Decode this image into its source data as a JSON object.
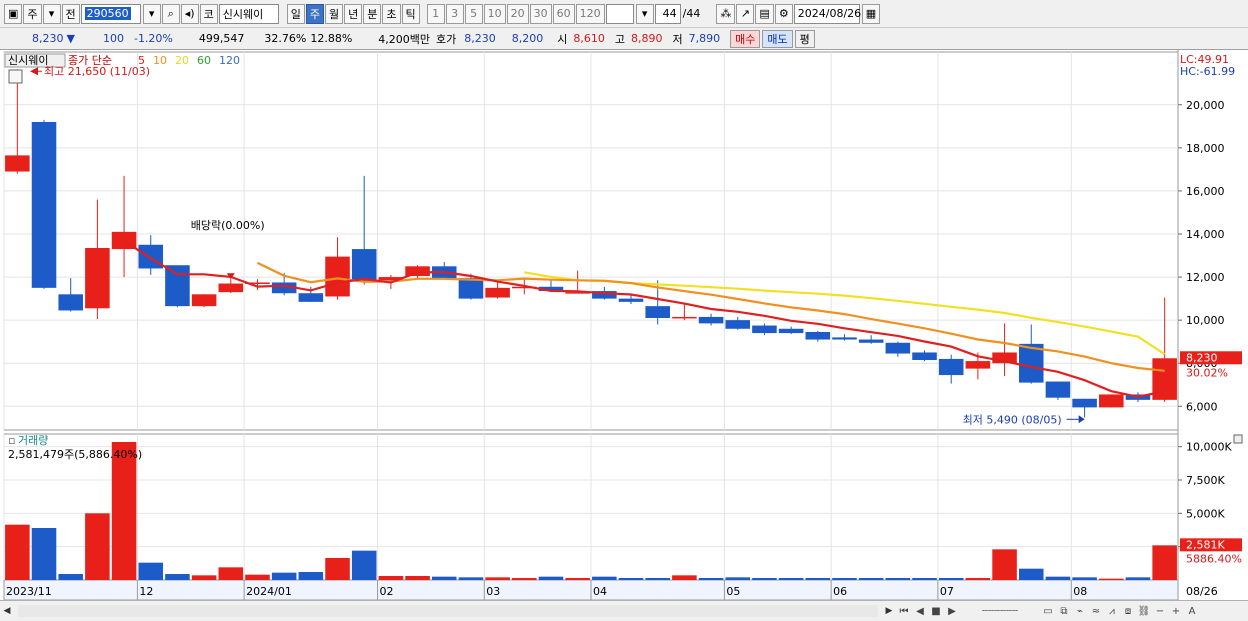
{
  "toolbar": {
    "period_label": "주",
    "prev_label": "전",
    "stock_code": "290560",
    "code_label": "코",
    "stock_name": "신시웨이",
    "tabs": [
      "일",
      "주",
      "월",
      "년",
      "분",
      "초",
      "틱"
    ],
    "active_tab": "주",
    "intervals": [
      "1",
      "3",
      "5",
      "10",
      "20",
      "30",
      "60",
      "120"
    ],
    "count": "44",
    "count_total": "/44",
    "date": "2024/08/26"
  },
  "quote": {
    "price": "8,230",
    "direction": "▼",
    "change": "100",
    "change_pct": "-1.20%",
    "volume": "499,547",
    "rate1": "32.76%",
    "rate2": "12.88%",
    "amount": "4,200백만",
    "hoga_label": "호가",
    "ask": "8,230",
    "bid": "8,200",
    "open_label": "시",
    "open": "8,610",
    "high_label": "고",
    "high": "8,890",
    "low_label": "저",
    "low": "7,890",
    "buy_label": "매수",
    "sell_label": "매도",
    "eval_label": "평"
  },
  "chart_data": {
    "type": "candlestick",
    "stock_name": "신시웨이",
    "legend": {
      "prefix": "종가 단순",
      "ma_periods": [
        "5",
        "10",
        "20",
        "60",
        "120"
      ],
      "ma_colors": [
        "#e02020",
        "#f09020",
        "#e8d820",
        "#30a030",
        "#3070c0"
      ]
    },
    "colors": {
      "up": "#e8201a",
      "down": "#1c5bc8",
      "ma5": "#e02020",
      "ma10": "#f09020",
      "ma20": "#f2e022"
    },
    "max_label": "최고 21,650 (11/03)",
    "min_label": "최저 5,490 (08/05)",
    "dividend_label": "배당락(0.00%)",
    "lc_label": "LC:49.91",
    "hc_label": "HC:-61.99",
    "current_price_tag": "8,230",
    "current_pct_tag": "30.02%",
    "price_ticks": [
      {
        "value": 6000,
        "label": "6,000"
      },
      {
        "value": 8000,
        "label": "8,000"
      },
      {
        "value": 10000,
        "label": "10,000"
      },
      {
        "value": 12000,
        "label": "12,000"
      },
      {
        "value": 14000,
        "label": "14,000"
      },
      {
        "value": 16000,
        "label": "16,000"
      },
      {
        "value": 18000,
        "label": "18,000"
      },
      {
        "value": 20000,
        "label": "20,000"
      }
    ],
    "price_range": [
      4900,
      22450
    ],
    "candles": [
      {
        "o": 16900,
        "h": 21650,
        "l": 16800,
        "c": 17650
      },
      {
        "o": 19200,
        "h": 19300,
        "l": 11450,
        "c": 11500
      },
      {
        "o": 11200,
        "h": 11950,
        "l": 10400,
        "c": 10450
      },
      {
        "o": 10550,
        "h": 15600,
        "l": 10050,
        "c": 13350
      },
      {
        "o": 13300,
        "h": 16700,
        "l": 12000,
        "c": 14100
      },
      {
        "o": 13500,
        "h": 13950,
        "l": 12100,
        "c": 12400
      },
      {
        "o": 12550,
        "h": 12550,
        "l": 10600,
        "c": 10650
      },
      {
        "o": 10650,
        "h": 11200,
        "l": 10600,
        "c": 11200
      },
      {
        "o": 11300,
        "h": 11900,
        "l": 11250,
        "c": 11700
      },
      {
        "o": 11750,
        "h": 11900,
        "l": 11400,
        "c": 11750
      },
      {
        "o": 11750,
        "h": 12200,
        "l": 11150,
        "c": 11250
      },
      {
        "o": 11250,
        "h": 11550,
        "l": 10850,
        "c": 10850
      },
      {
        "o": 11100,
        "h": 13850,
        "l": 10950,
        "c": 12950
      },
      {
        "o": 13300,
        "h": 16700,
        "l": 11650,
        "c": 11800
      },
      {
        "o": 11850,
        "h": 12100,
        "l": 11450,
        "c": 12000
      },
      {
        "o": 12050,
        "h": 12550,
        "l": 11950,
        "c": 12500
      },
      {
        "o": 12500,
        "h": 12700,
        "l": 11900,
        "c": 11950
      },
      {
        "o": 11950,
        "h": 12150,
        "l": 10950,
        "c": 11000
      },
      {
        "o": 11050,
        "h": 11750,
        "l": 11000,
        "c": 11500
      },
      {
        "o": 11500,
        "h": 11900,
        "l": 11200,
        "c": 11550
      },
      {
        "o": 11550,
        "h": 11900,
        "l": 11300,
        "c": 11350
      },
      {
        "o": 11300,
        "h": 12300,
        "l": 11250,
        "c": 11300
      },
      {
        "o": 11350,
        "h": 11550,
        "l": 10950,
        "c": 11000
      },
      {
        "o": 11000,
        "h": 11200,
        "l": 10750,
        "c": 10850
      },
      {
        "o": 10650,
        "h": 11850,
        "l": 9800,
        "c": 10100
      },
      {
        "o": 10100,
        "h": 10800,
        "l": 10000,
        "c": 10150
      },
      {
        "o": 10150,
        "h": 10300,
        "l": 9750,
        "c": 9850
      },
      {
        "o": 10000,
        "h": 10150,
        "l": 9550,
        "c": 9600
      },
      {
        "o": 9750,
        "h": 9850,
        "l": 9300,
        "c": 9400
      },
      {
        "o": 9600,
        "h": 9700,
        "l": 9350,
        "c": 9400
      },
      {
        "o": 9450,
        "h": 9500,
        "l": 9000,
        "c": 9100
      },
      {
        "o": 9200,
        "h": 9350,
        "l": 9050,
        "c": 9100
      },
      {
        "o": 9100,
        "h": 9300,
        "l": 8900,
        "c": 8950
      },
      {
        "o": 8950,
        "h": 9000,
        "l": 8300,
        "c": 8450
      },
      {
        "o": 8500,
        "h": 8600,
        "l": 8100,
        "c": 8150
      },
      {
        "o": 8200,
        "h": 8400,
        "l": 7050,
        "c": 7450
      },
      {
        "o": 7750,
        "h": 8500,
        "l": 7250,
        "c": 8100
      },
      {
        "o": 8000,
        "h": 9850,
        "l": 7400,
        "c": 8500
      },
      {
        "o": 8900,
        "h": 9800,
        "l": 7050,
        "c": 7100
      },
      {
        "o": 7150,
        "h": 7150,
        "l": 6300,
        "c": 6400
      },
      {
        "o": 6350,
        "h": 6350,
        "l": 5490,
        "c": 5950
      },
      {
        "o": 5950,
        "h": 6550,
        "l": 5950,
        "c": 6550
      },
      {
        "o": 6550,
        "h": 6650,
        "l": 6200,
        "c": 6300
      },
      {
        "o": 6300,
        "h": 11050,
        "l": 6200,
        "c": 8230
      }
    ],
    "ma5": [
      null,
      null,
      null,
      null,
      13680,
      12870,
      12130,
      12130,
      12010,
      11560,
      11600,
      11380,
      11740,
      11910,
      11750,
      12220,
      12230,
      12050,
      11790,
      11590,
      11360,
      11340,
      11250,
      11190,
      10980,
      10770,
      10520,
      10390,
      10200,
      9970,
      9830,
      9620,
      9440,
      9270,
      9010,
      8770,
      8320,
      8090,
      7830,
      7600,
      7210,
      6700,
      6440,
      6700
    ],
    "ma10": [
      null,
      null,
      null,
      null,
      null,
      null,
      null,
      null,
      null,
      12660,
      12060,
      11760,
      11940,
      11780,
      11790,
      11920,
      11920,
      11880,
      11850,
      11930,
      11880,
      11850,
      11830,
      11720,
      11520,
      11350,
      11180,
      10980,
      10780,
      10590,
      10450,
      10280,
      10050,
      9840,
      9620,
      9370,
      9100,
      8940,
      8710,
      8550,
      8310,
      8000,
      7780,
      7650
    ],
    "ma20": [
      null,
      null,
      null,
      null,
      null,
      null,
      null,
      null,
      null,
      null,
      null,
      null,
      null,
      null,
      null,
      null,
      null,
      null,
      null,
      12220,
      12010,
      11850,
      11810,
      11720,
      11660,
      11600,
      11530,
      11460,
      11370,
      11300,
      11230,
      11140,
      11020,
      10900,
      10760,
      10620,
      10490,
      10330,
      10110,
      9910,
      9700,
      9470,
      9230,
      8420
    ],
    "volume_title": "거래량",
    "volume_label": "2,581,479주(5,886.40%)",
    "volume_ticks": [
      {
        "value": 2500,
        "label": ""
      },
      {
        "value": 5000,
        "label": "5,000K"
      },
      {
        "value": 7500,
        "label": "7,500K"
      },
      {
        "value": 10000,
        "label": "10,000K"
      }
    ],
    "volume_range": [
      0,
      10500
    ],
    "volume_tag": "2,581K",
    "volume_pct_tag": "5886.40%",
    "volumes": [
      4150,
      3900,
      450,
      5000,
      10350,
      1300,
      450,
      350,
      950,
      400,
      550,
      600,
      1650,
      2200,
      300,
      300,
      250,
      200,
      200,
      150,
      250,
      150,
      250,
      150,
      150,
      350,
      150,
      200,
      150,
      150,
      150,
      150,
      150,
      150,
      150,
      150,
      150,
      2300,
      850,
      250,
      200,
      100,
      200,
      2600
    ],
    "x_labels": [
      {
        "idx": 0,
        "label": "2023/11"
      },
      {
        "idx": 5,
        "label": "12"
      },
      {
        "idx": 9,
        "label": "2024/01"
      },
      {
        "idx": 14,
        "label": "02"
      },
      {
        "idx": 18,
        "label": "03"
      },
      {
        "idx": 22,
        "label": "04"
      },
      {
        "idx": 27,
        "label": "05"
      },
      {
        "idx": 31,
        "label": "06"
      },
      {
        "idx": 35,
        "label": "07"
      },
      {
        "idx": 40,
        "label": "08"
      }
    ],
    "last_date_label": "08/26"
  }
}
